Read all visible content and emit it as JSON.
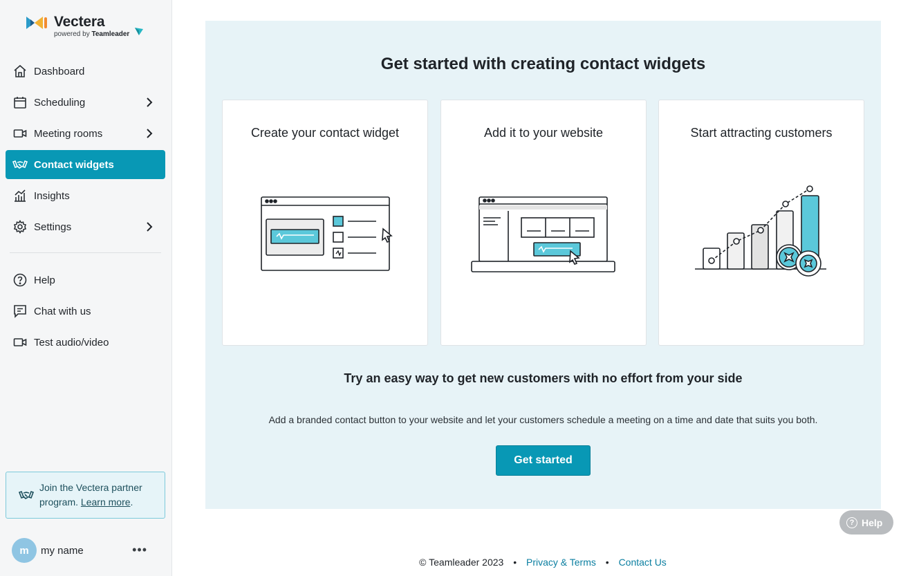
{
  "brand": {
    "name": "Vectera",
    "powered_prefix": "powered by",
    "powered_name": "Teamleader",
    "accent_color": "#0898b5"
  },
  "sidebar": {
    "items": [
      {
        "label": "Dashboard",
        "icon": "home-icon"
      },
      {
        "label": "Scheduling",
        "icon": "calendar-icon",
        "has_submenu": true
      },
      {
        "label": "Meeting rooms",
        "icon": "video-icon",
        "has_submenu": true
      },
      {
        "label": "Contact widgets",
        "icon": "handshake-icon",
        "active": true
      },
      {
        "label": "Insights",
        "icon": "chart-icon"
      },
      {
        "label": "Settings",
        "icon": "gear-icon",
        "has_submenu": true
      }
    ],
    "secondary": [
      {
        "label": "Help",
        "icon": "question-icon"
      },
      {
        "label": "Chat with us",
        "icon": "chat-icon"
      },
      {
        "label": "Test audio/video",
        "icon": "video-icon"
      }
    ],
    "partner": {
      "text": "Join the Vectera partner program.",
      "link": "Learn more",
      "suffix": "."
    },
    "user": {
      "initial": "m",
      "name": "my name",
      "more": "•••"
    }
  },
  "main": {
    "title": "Get started with creating contact widgets",
    "cards": [
      {
        "title": "Create your contact widget"
      },
      {
        "title": "Add it to your website"
      },
      {
        "title": "Start attracting customers"
      }
    ],
    "subtitle": "Try an easy way to get new customers with no effort from your side",
    "description": "Add a branded contact button to your website and let your customers schedule a meeting on a time and date that suits you both.",
    "cta": "Get started"
  },
  "help_button": {
    "label": "Help",
    "icon_glyph": "?"
  },
  "footer": {
    "copyright": "© Teamleader 2023",
    "separator": "•",
    "privacy": "Privacy & Terms",
    "contact": "Contact Us"
  }
}
